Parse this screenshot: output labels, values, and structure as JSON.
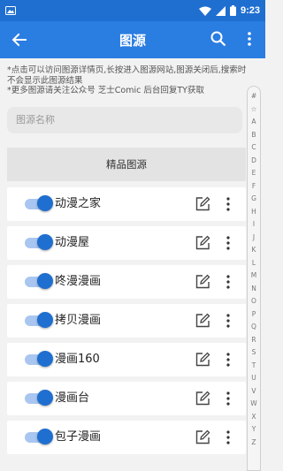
{
  "status_bar": {
    "time": "9:23"
  },
  "app_bar": {
    "title": "图源"
  },
  "notice": {
    "line1": "*点击可以访问图源详情页,长按进入图源网站,图源关闭后,搜索时不会显示此图源结果",
    "line2": "*更多图源请关注公众号 芝士Comic 后台回复TY获取"
  },
  "search": {
    "placeholder": "图源名称"
  },
  "section": {
    "title": "精品图源"
  },
  "sources": [
    {
      "name": "动漫之家",
      "enabled": true
    },
    {
      "name": "动漫屋",
      "enabled": true
    },
    {
      "name": "咚漫漫画",
      "enabled": true
    },
    {
      "name": "拷贝漫画",
      "enabled": true
    },
    {
      "name": "漫画160",
      "enabled": true
    },
    {
      "name": "漫画台",
      "enabled": true
    },
    {
      "name": "包子漫画",
      "enabled": true
    }
  ],
  "index_letters": [
    "#",
    "☆",
    "A",
    "B",
    "C",
    "D",
    "E",
    "F",
    "G",
    "H",
    "I",
    "J",
    "K",
    "L",
    "M",
    "N",
    "O",
    "P",
    "Q",
    "R",
    "S",
    "T",
    "U",
    "V",
    "W",
    "X",
    "Y",
    "Z"
  ],
  "colors": {
    "primary": "#2a7de1",
    "status": "#1f6fd0",
    "toggle_on": "#1f6fd0"
  }
}
